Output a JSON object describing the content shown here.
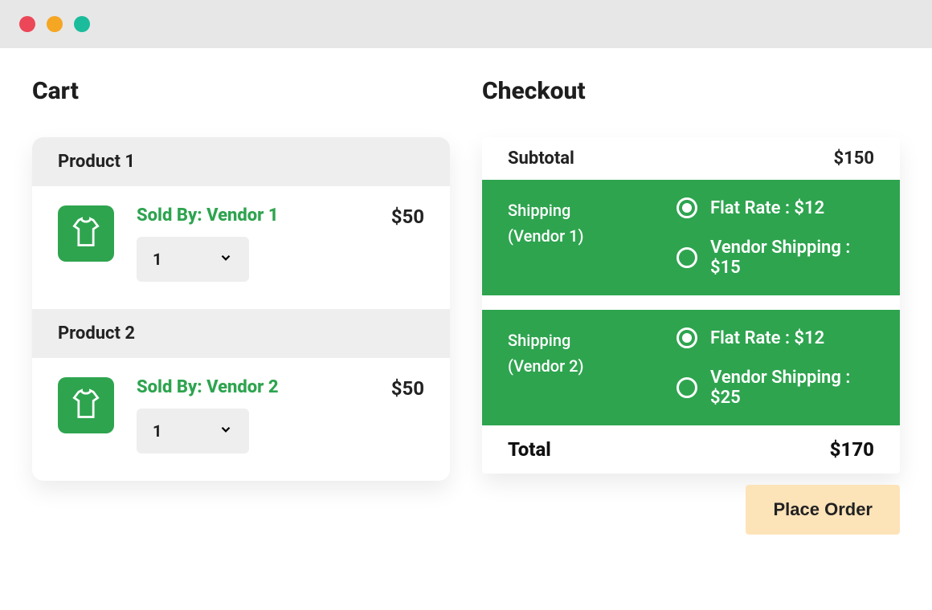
{
  "cart": {
    "title": "Cart",
    "items": [
      {
        "header": "Product 1",
        "sold_by": "Sold By: Vendor 1",
        "qty": "1",
        "price": "$50"
      },
      {
        "header": "Product 2",
        "sold_by": "Sold By: Vendor 2",
        "qty": "1",
        "price": "$50"
      }
    ]
  },
  "checkout": {
    "title": "Checkout",
    "subtotal_label": "Subtotal",
    "subtotal_value": "$150",
    "shipping": [
      {
        "label_line1": "Shipping",
        "label_line2": "(Vendor 1)",
        "options": [
          {
            "text": "Flat Rate : $12",
            "checked": true
          },
          {
            "text": "Vendor Shipping : $15",
            "checked": false
          }
        ]
      },
      {
        "label_line1": "Shipping",
        "label_line2": "(Vendor 2)",
        "options": [
          {
            "text": "Flat Rate : $12",
            "checked": true
          },
          {
            "text": "Vendor Shipping : $25",
            "checked": false
          }
        ]
      }
    ],
    "total_label": "Total",
    "total_value": "$170",
    "place_order_label": "Place Order"
  }
}
